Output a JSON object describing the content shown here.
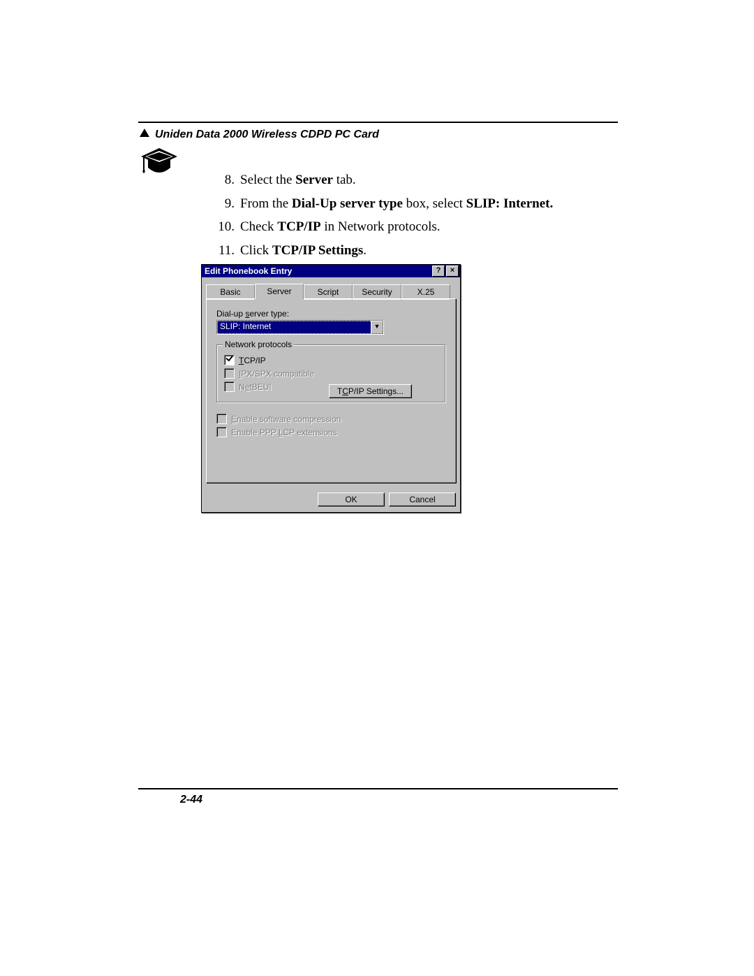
{
  "header": {
    "title": "Uniden Data 2000 Wireless CDPD PC Card"
  },
  "steps": [
    {
      "num": "8.",
      "prefix": "Select the ",
      "bold1": "Server",
      "suffix1": " tab."
    },
    {
      "num": "9.",
      "prefix": "From the ",
      "bold1": "Dial-Up server type",
      "mid": " box, select ",
      "bold2": "SLIP: Internet.",
      "suffix1": ""
    },
    {
      "num": "10.",
      "prefix": "Check ",
      "bold1": "TCP/IP",
      "suffix1": " in Network protocols."
    },
    {
      "num": "11.",
      "prefix": "Click ",
      "bold1": "TCP/IP Settings",
      "suffix1": "."
    }
  ],
  "dialog": {
    "title": "Edit Phonebook Entry",
    "help_btn": "?",
    "close_btn": "×",
    "tabs": [
      "Basic",
      "Server",
      "Script",
      "Security",
      "X.25"
    ],
    "active_tab": 1,
    "server_type_label_pre": "Dial-up ",
    "server_type_label_u": "s",
    "server_type_label_post": "erver type:",
    "server_type_value": "SLIP: Internet",
    "combo_arrow": "▼",
    "group_title": "Network protocols",
    "tcpip_u": "T",
    "tcpip_post": "CP/IP",
    "ipx_u": "I",
    "ipx_post": "PX/SPX compatible",
    "netbeui_pre": "N",
    "netbeui_u": "e",
    "netbeui_post": "tBEUI",
    "tcpip_settings_pre": "T",
    "tcpip_settings_u": "C",
    "tcpip_settings_post": "P/IP Settings...",
    "sw_comp_u": "E",
    "sw_comp_post": "nable software compression",
    "ppp_ext_pre": "Enable PPP ",
    "ppp_ext_u": "L",
    "ppp_ext_post": "CP extensions",
    "ok": "OK",
    "cancel": "Cancel"
  },
  "footer": {
    "page_num": "2-44"
  }
}
